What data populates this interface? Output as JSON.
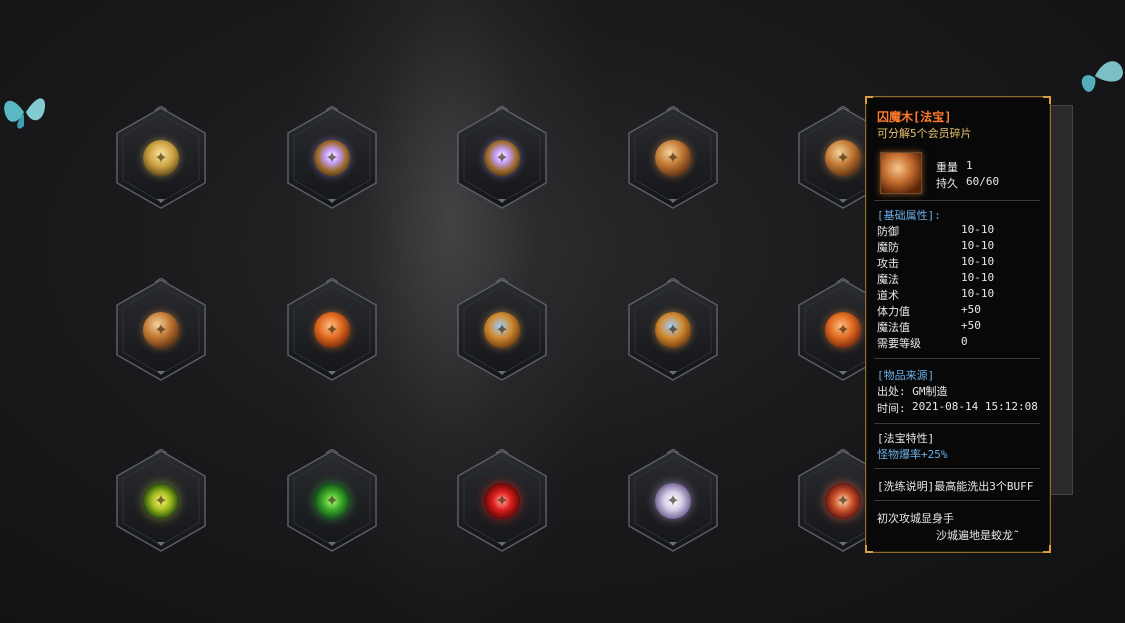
{
  "slots": [
    {
      "gem": "gold"
    },
    {
      "gem": "purple"
    },
    {
      "gem": "purple"
    },
    {
      "gem": "bronze"
    },
    {
      "gem": "bronze"
    },
    {
      "gem": "bronze"
    },
    {
      "gem": "swirl-red"
    },
    {
      "gem": "swirl-blue"
    },
    {
      "gem": "swirl-blue"
    },
    {
      "gem": "swirl-red"
    },
    {
      "gem": "green-y"
    },
    {
      "gem": "green"
    },
    {
      "gem": "red"
    },
    {
      "gem": "white"
    },
    {
      "gem": "fire"
    }
  ],
  "tooltip": {
    "title": "囚魔木[法宝]",
    "subtitle": "可分解5个会员碎片",
    "weight_label": "重量",
    "weight_value": "1",
    "durability_label": "持久",
    "durability_value": "60/60",
    "base_header": "[基础属性]:",
    "stats": [
      {
        "name": "防御",
        "value": "10-10"
      },
      {
        "name": "魔防",
        "value": "10-10"
      },
      {
        "name": "攻击",
        "value": "10-10"
      },
      {
        "name": "魔法",
        "value": "10-10"
      },
      {
        "name": "道术",
        "value": "10-10"
      },
      {
        "name": "体力值",
        "value": "+50"
      },
      {
        "name": "魔法值",
        "value": "+50"
      },
      {
        "name": "需要等级",
        "value": "0"
      }
    ],
    "source_header": "[物品来源]",
    "source_origin": "出处: GM制造",
    "source_time_label": "时间:",
    "source_time_value": "2021-08-14 15:12:08",
    "feature_header": "[法宝特性]",
    "feature_text": "怪物爆率+25%",
    "refine_text": "[洗练说明]最高能洗出3个BUFF",
    "poem_line1": "初次攻城显身手",
    "poem_line2": "沙城遍地是蛟龙˜"
  }
}
